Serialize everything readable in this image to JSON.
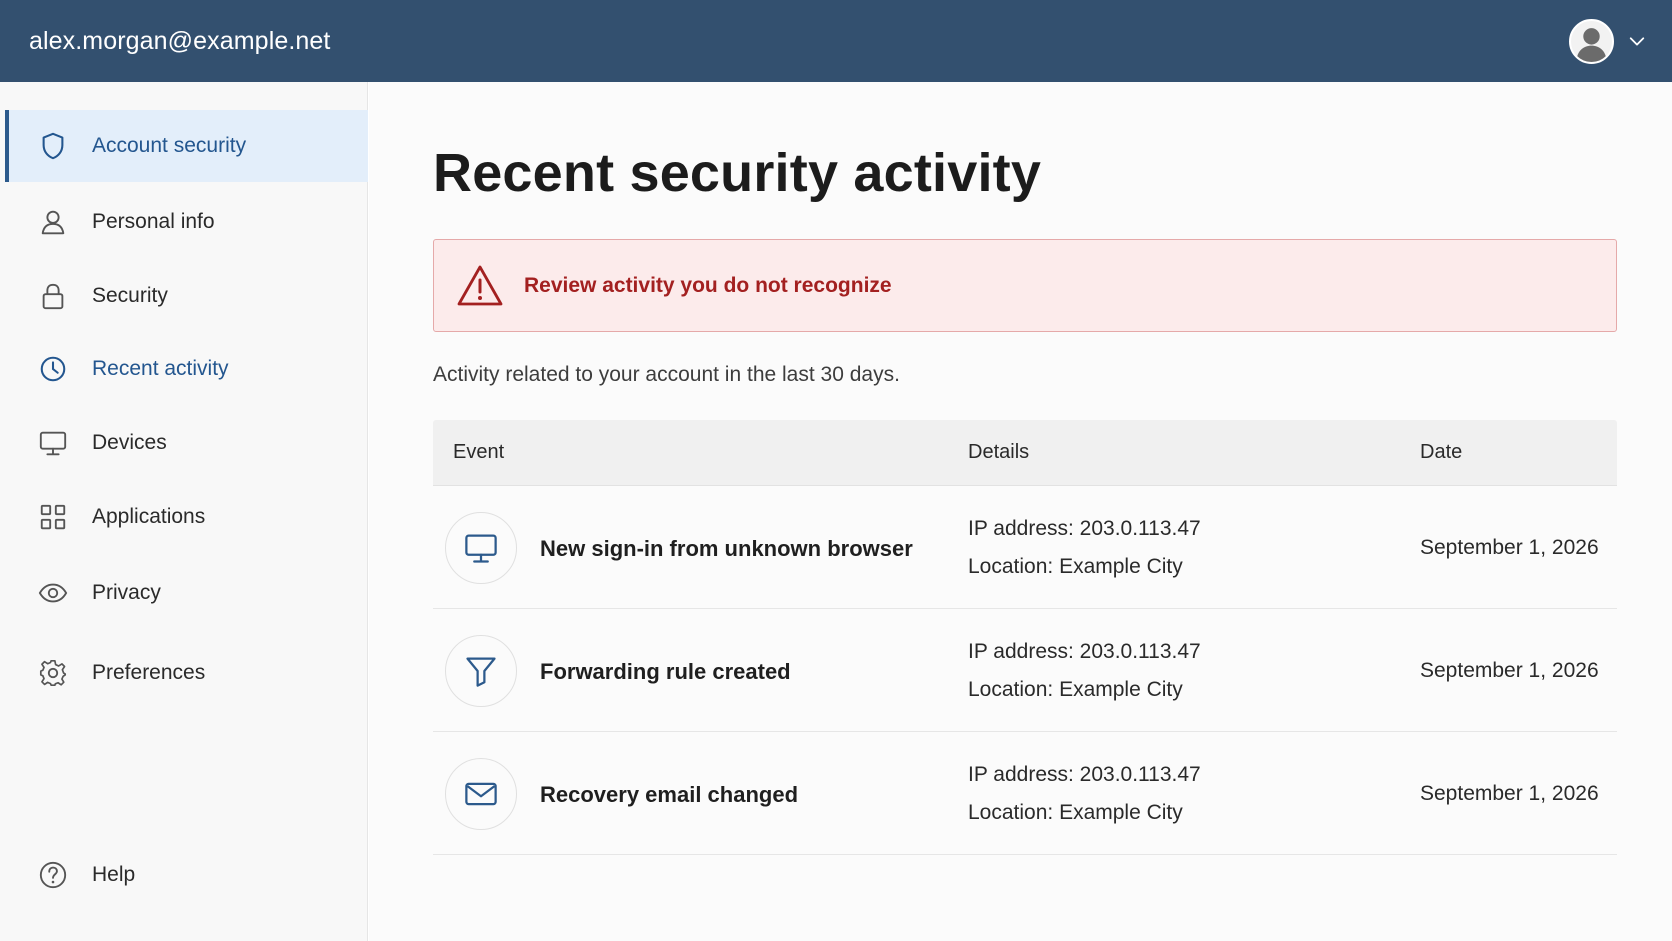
{
  "header": {
    "account_email": "alex.morgan@example.net",
    "avatar_icon": "user-avatar-icon",
    "menu_icon": "chevron-down-icon"
  },
  "sidebar": {
    "items": [
      {
        "label": "Account security",
        "icon": "shield-icon",
        "active": true
      },
      {
        "label": "Personal info",
        "icon": "person-icon"
      },
      {
        "label": "Security",
        "icon": "lock-icon"
      },
      {
        "label": "Recent activity",
        "icon": "clock-icon",
        "highlighted": true
      },
      {
        "label": "Devices",
        "icon": "monitor-icon"
      },
      {
        "label": "Applications",
        "icon": "grid-icon"
      },
      {
        "label": "Privacy",
        "icon": "eye-icon"
      },
      {
        "label": "Preferences",
        "icon": "gear-icon"
      }
    ],
    "help": {
      "label": "Help",
      "icon": "question-circle-icon"
    }
  },
  "main": {
    "title": "Recent security activity",
    "alert": {
      "text": "Review activity you do not recognize",
      "icon": "warning-triangle-icon"
    },
    "subtitle": "Activity related to your account in the last 30 days.",
    "table": {
      "headers": {
        "event": "Event",
        "details": "Details",
        "date": "Date"
      },
      "rows": [
        {
          "icon": "monitor-icon",
          "event": "New sign-in from unknown browser",
          "ip": "IP address: 203.0.113.47",
          "location": "Location: Example City",
          "date": "September 1, 2026"
        },
        {
          "icon": "filter-icon",
          "event": "Forwarding rule created",
          "ip": "IP address: 203.0.113.47",
          "location": "Location: Example City",
          "date": "September 1, 2026"
        },
        {
          "icon": "envelope-icon",
          "event": "Recovery email changed",
          "ip": "IP address: 203.0.113.47",
          "location": "Location: Example City",
          "date": "September 1, 2026"
        }
      ]
    }
  },
  "colors": {
    "header_bg": "#33506f",
    "accent": "#23568f",
    "active_bg": "#e3eefa",
    "alert_bg": "#fcebeb",
    "alert_text": "#a32020"
  }
}
